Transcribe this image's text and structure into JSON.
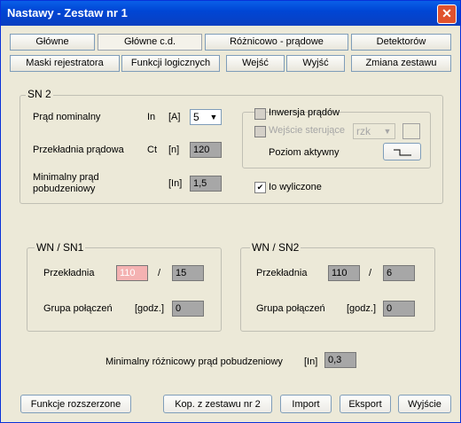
{
  "window": {
    "title": "Nastawy  -  Zestaw nr 1"
  },
  "tabs": {
    "row1": [
      "Główne",
      "Główne c.d.",
      "Różnicowo - prądowe",
      "Detektorów"
    ],
    "row2": [
      "Maski rejestratora",
      "Funkcji logicznych",
      "Wejść",
      "Wyjść",
      "Zmiana zestawu"
    ]
  },
  "sn2": {
    "title": "SN 2",
    "current_label": "Prąd nominalny",
    "current_symbol": "In",
    "current_unit": "[A]",
    "current_value": "5",
    "ratio_label": "Przekładnia prądowa",
    "ratio_symbol": "Ct",
    "ratio_unit": "[n]",
    "ratio_value": "120",
    "min_label_1": "Minimalny prąd",
    "min_label_2": "pobudzeniowy",
    "min_unit": "[In]",
    "min_value": "1,5",
    "inversion_label": "Inwersja prądów",
    "input_label": "Wejście sterujące",
    "input_value": "rzk",
    "active_level_label": "Poziom aktywny",
    "io_label": "Io wyliczone",
    "io_checked": true
  },
  "wn_sn1": {
    "title": "WN / SN1",
    "ratio_label": "Przekładnia",
    "ratio_a": "110",
    "ratio_b": "15",
    "group_label": "Grupa połączeń",
    "group_unit": "[godz.]",
    "group_value": "0"
  },
  "wn_sn2": {
    "title": "WN / SN2",
    "ratio_label": "Przekładnia",
    "ratio_a": "110",
    "ratio_b": "6",
    "group_label": "Grupa połączeń",
    "group_unit": "[godz.]",
    "group_value": "0"
  },
  "min_diff": {
    "label": "Minimalny różnicowy prąd pobudzeniowy",
    "unit": "[In]",
    "value": "0,3"
  },
  "separator": "/",
  "buttons": {
    "extended": "Funkcje rozszerzone",
    "copy": "Kop. z zestawu nr 2",
    "import": "Import",
    "export": "Eksport",
    "exit": "Wyjście"
  },
  "colors": {
    "titlebar": "#0046d5",
    "window_bg": "#ece9d8",
    "field_bg": "#a7a7a7",
    "field_highlight": "#f4b2b2"
  }
}
